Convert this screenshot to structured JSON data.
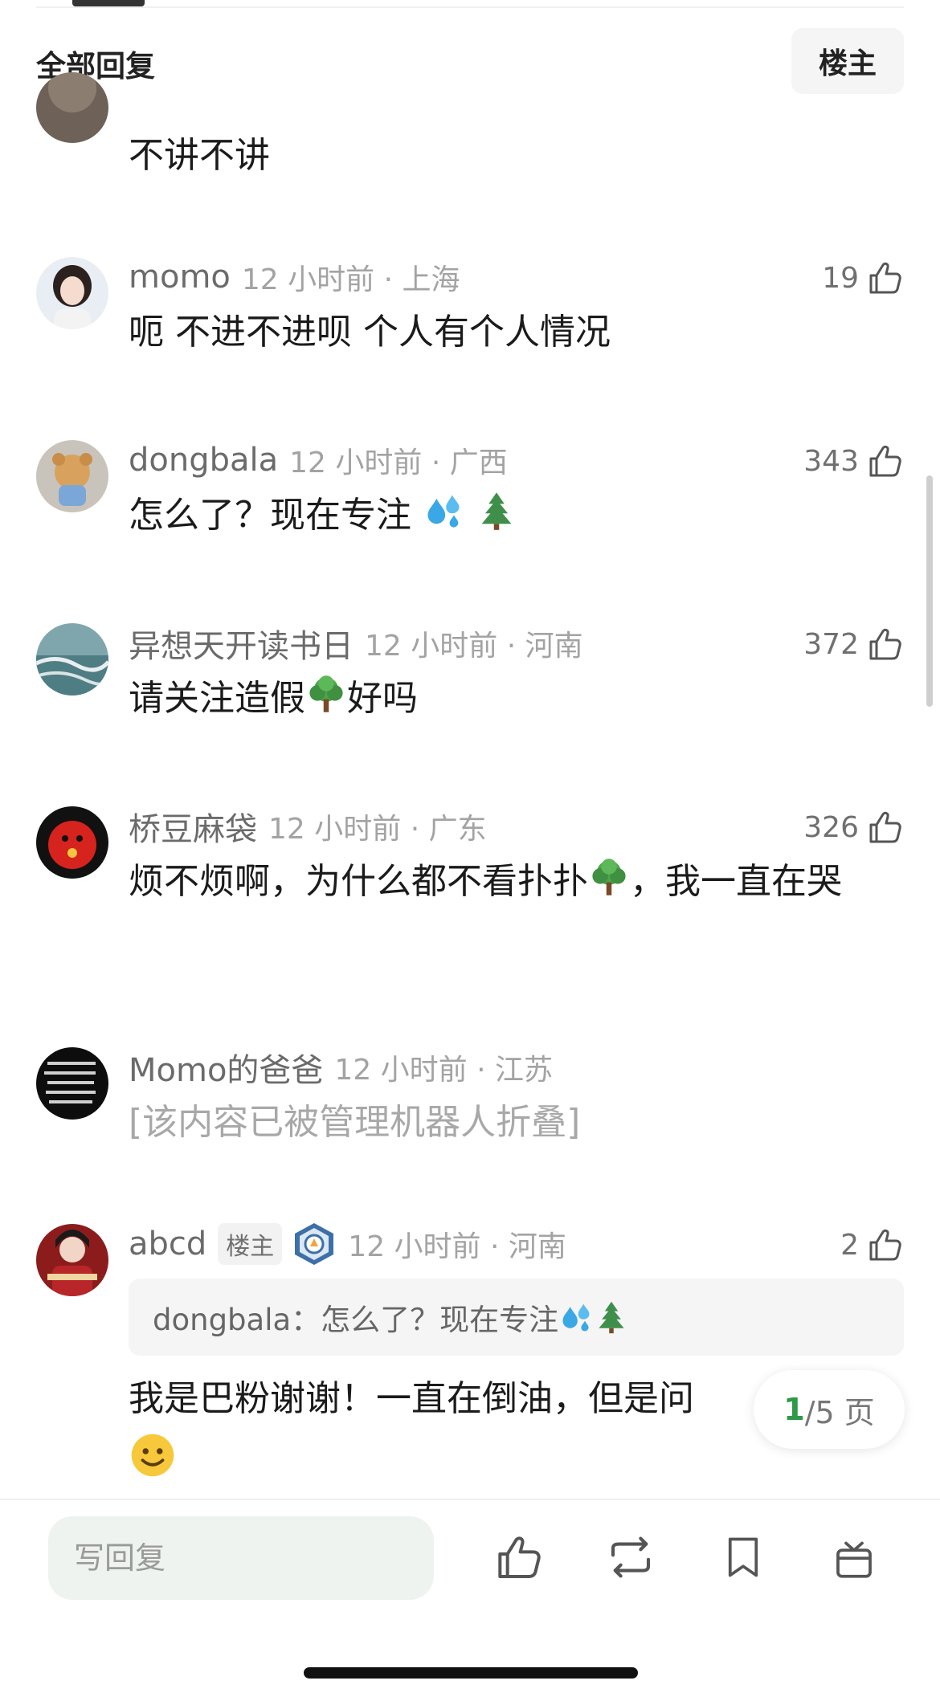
{
  "header": {
    "title": "全部回复",
    "louzhu_button": "楼主"
  },
  "comments": [
    {
      "text": "不讲不讲"
    },
    {
      "username": "momo",
      "time_location": "12 小时前 · 上海",
      "likes": "19",
      "text": "呃 不进不进呗 个人有个人情况"
    },
    {
      "username": "dongbala",
      "time_location": "12 小时前 · 广西",
      "likes": "343",
      "text": "怎么了？现在专注"
    },
    {
      "username": "异想天开读书日",
      "time_location": "12 小时前 · 河南",
      "likes": "372",
      "text_a": "请关注造假",
      "text_b": "好吗"
    },
    {
      "username": "桥豆麻袋",
      "time_location": "12 小时前 · 广东",
      "likes": "326",
      "text_a": "烦不烦啊，为什么都不看扑扑",
      "text_b": "，我一直在哭"
    },
    {
      "username": "Momo的爸爸",
      "time_location": "12 小时前 · 江苏",
      "folded": "[该内容已被管理机器人折叠]"
    },
    {
      "username": "abcd",
      "tag": "楼主",
      "time_location": "12 小时前 · 河南",
      "likes": "2",
      "quote": "dongbala：怎么了？现在专注",
      "text": "我是巴粉谢谢！一直在倒油，但是问"
    }
  ],
  "pager": {
    "current": "1",
    "rest": "/5 页"
  },
  "bottom_bar": {
    "reply_placeholder": "写回复"
  },
  "icons": [
    "thumbs-up-icon",
    "repost-icon",
    "bookmark-icon",
    "gift-icon",
    "droplets-emoji",
    "evergreen-tree-emoji",
    "tree-emoji",
    "smiley-emoji"
  ],
  "colors": {
    "accent_green": "#2e9a48",
    "username_gray": "#6b6b6b",
    "meta_gray": "#a3a3a3"
  }
}
